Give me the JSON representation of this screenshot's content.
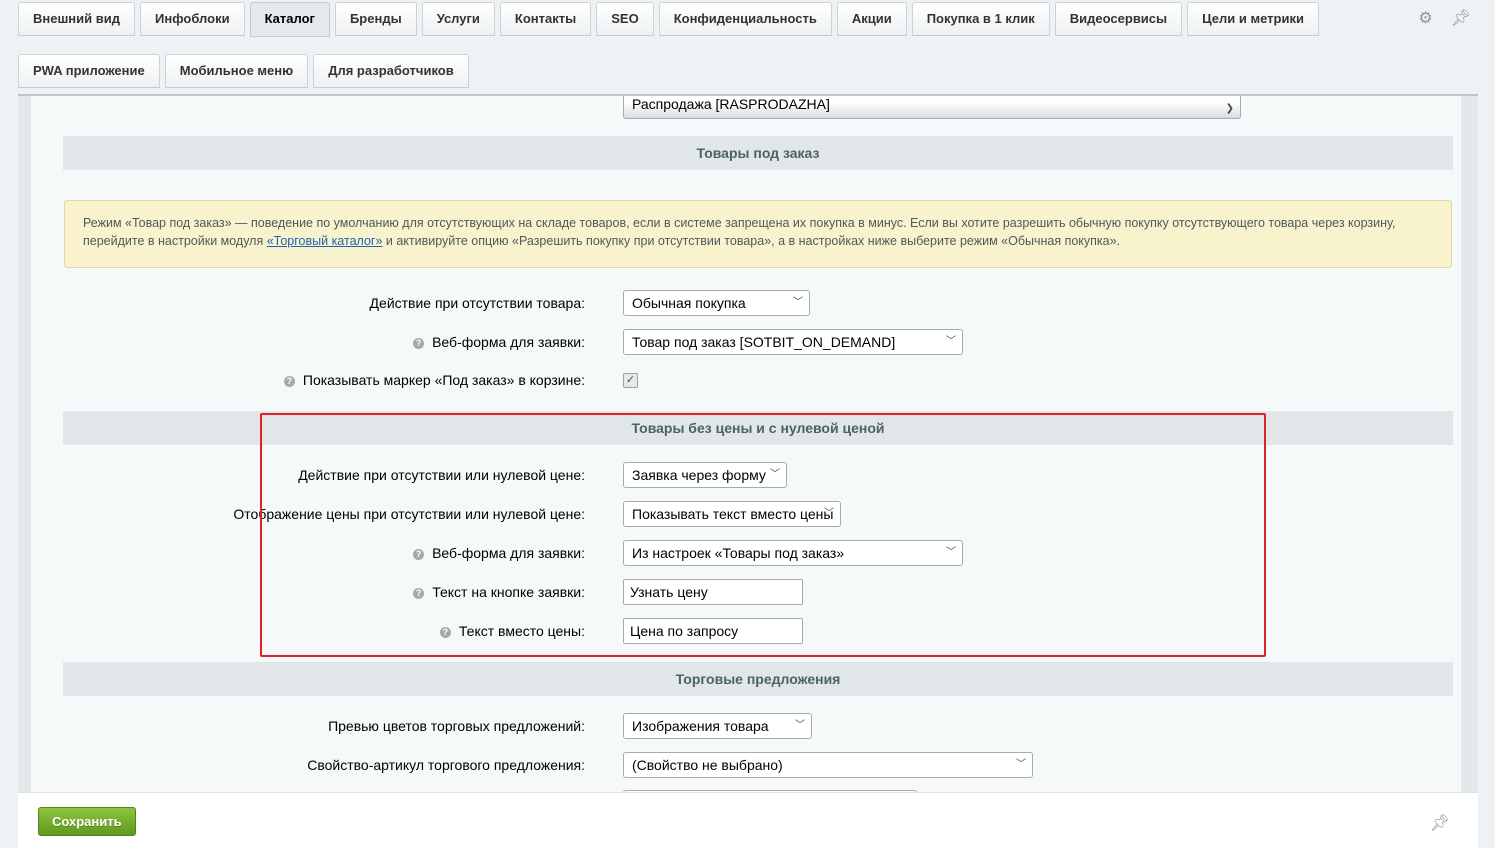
{
  "tabs_row1": [
    {
      "label": "Внешний вид"
    },
    {
      "label": "Инфоблоки"
    },
    {
      "label": "Каталог",
      "active": true
    },
    {
      "label": "Бренды"
    },
    {
      "label": "Услуги"
    },
    {
      "label": "Контакты"
    },
    {
      "label": "SEO"
    },
    {
      "label": "Конфиденциальность"
    },
    {
      "label": "Акции"
    },
    {
      "label": "Покупка в 1 клик"
    },
    {
      "label": "Видеосервисы"
    },
    {
      "label": "Цели и метрики"
    }
  ],
  "tabs_row2": [
    {
      "label": "PWA приложение"
    },
    {
      "label": "Мобильное меню"
    },
    {
      "label": "Для разработчиков"
    }
  ],
  "icons": {
    "settings": "gear-icon",
    "pin": "pin-icon"
  },
  "top_select": {
    "value": "Распродажа [RASPRODAZHA]"
  },
  "section_on_demand": {
    "title": "Товары под заказ",
    "notice": {
      "text_before": "Режим «Товар под заказ» — поведение по умолчанию для отсутствующих на складе товаров, если в системе запрещена их покупка в минус. Если вы хотите разрешить обычную покупку отсутствующего товара через корзину, перейдите в настройки модуля ",
      "link": "«Торговый каталог»",
      "text_after": " и активируйте опцию «Разрешить покупку при отсутствии товара», а в настройках ниже выберите режим «Обычная покупка»."
    },
    "action_label": "Действие при отсутствии товара:",
    "action_value": "Обычная покупка",
    "webform_label": "Веб-форма для заявки:",
    "webform_value": "Товар под заказ [SOTBIT_ON_DEMAND]",
    "marker_label": "Показывать маркер «Под заказ» в корзине:",
    "marker_checked": true
  },
  "section_no_price": {
    "title": "Товары без цены и с нулевой ценой",
    "action_label": "Действие при отсутствии или нулевой цене:",
    "action_value": "Заявка через форму",
    "display_label": "Отображение цены при отсутствии или нулевой цене:",
    "display_value": "Показывать текст вместо цены",
    "webform_label": "Веб-форма для заявки:",
    "webform_value": "Из настроек «Товары под заказ»",
    "button_text_label": "Текст на кнопке заявки:",
    "button_text_value": "Узнать цену",
    "price_text_label": "Текст вместо цены:",
    "price_text_value": "Цена по запросу"
  },
  "section_offers": {
    "title": "Торговые предложения",
    "preview_label": "Превью цветов торговых предложений:",
    "preview_value": "Изображения товара",
    "article_label": "Свойство-артикул торгового предложения:",
    "article_value": "(Свойство не выбрано)"
  },
  "footer": {
    "save_label": "Сохранить"
  },
  "colors": {
    "highlight": "#e0202a",
    "save_button": "#6fab28",
    "notice_bg": "#f8f2cd"
  }
}
